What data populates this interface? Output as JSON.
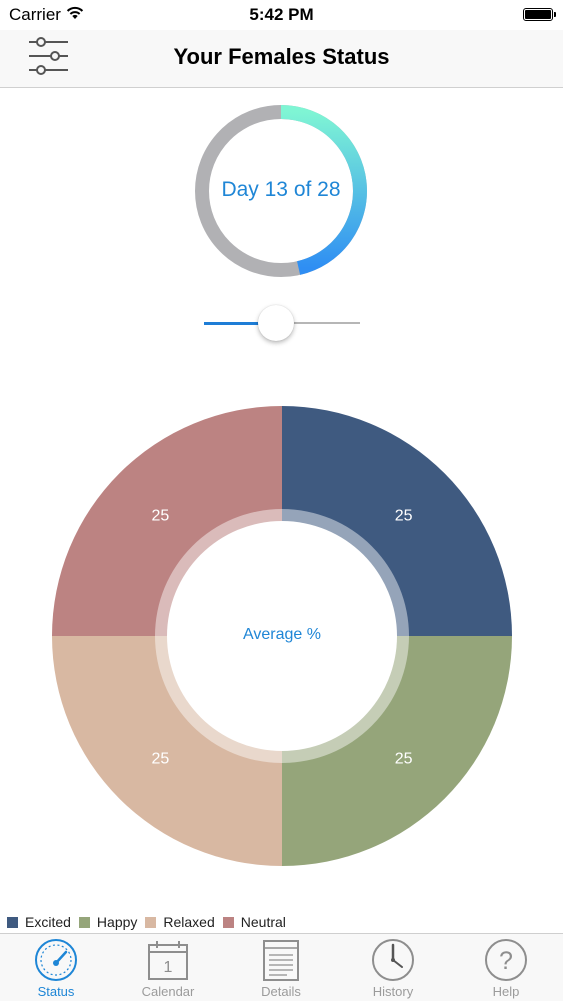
{
  "status_bar": {
    "carrier": "Carrier",
    "time": "5:42 PM"
  },
  "nav": {
    "title": "Your Females Status",
    "filter_icon": "sliders-icon"
  },
  "cycle": {
    "label": "Day 13 of 28",
    "day": 13,
    "total": 28,
    "progress_color_start": "#7ff5d4",
    "progress_color_end": "#2f8ef3",
    "track_color": "#b1b1b4"
  },
  "slider": {
    "value_fraction": 0.46
  },
  "chart_data": {
    "type": "pie",
    "center_label": "Average %",
    "slices": [
      {
        "name": "Excited",
        "value": 25,
        "color": "#3f5a80"
      },
      {
        "name": "Happy",
        "value": 25,
        "color": "#95a57a"
      },
      {
        "name": "Relaxed",
        "value": 25,
        "color": "#d8b8a2"
      },
      {
        "name": "Neutral",
        "value": 25,
        "color": "#bc8382"
      }
    ],
    "legend_position": "bottom-left"
  },
  "tabs": [
    {
      "label": "Status",
      "icon": "speedometer-icon",
      "active": true
    },
    {
      "label": "Calendar",
      "icon": "calendar-icon",
      "active": false,
      "icon_text": "1"
    },
    {
      "label": "Details",
      "icon": "document-icon",
      "active": false
    },
    {
      "label": "History",
      "icon": "clock-icon",
      "active": false
    },
    {
      "label": "Help",
      "icon": "question-icon",
      "active": false,
      "icon_text": "?"
    }
  ]
}
